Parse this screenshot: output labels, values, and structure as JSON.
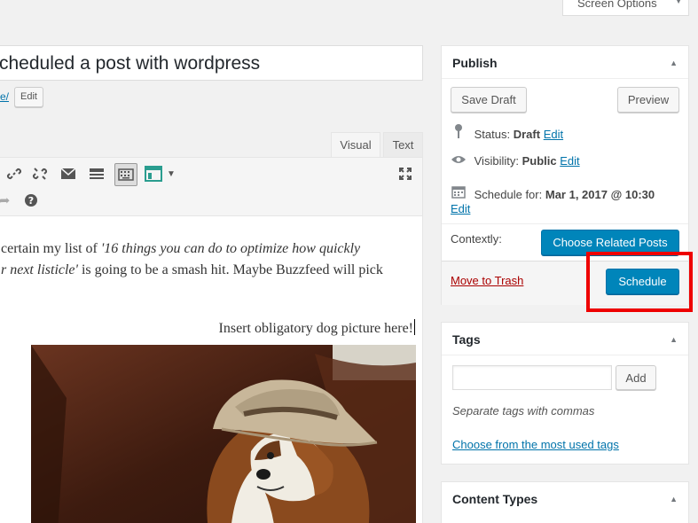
{
  "screen_options": {
    "label": "Screen Options",
    "arrow": "▼"
  },
  "post": {
    "title": "cheduled a post with wordpress",
    "permalink_tail": "e/",
    "edit_slug_label": "Edit"
  },
  "editor": {
    "tabs": {
      "visual": "Visual",
      "text": "Text"
    },
    "toolbar": {
      "row1": [
        "link-icon",
        "unlink-icon",
        "email-icon",
        "read-more-icon",
        "toolbar-toggle-icon",
        "content-block-icon",
        "dropdown-icon",
        "fullscreen-icon"
      ],
      "row2": [
        "redo-icon",
        "help-icon"
      ]
    },
    "content": {
      "p1_start": "certain my list of ",
      "p1_italic": "'16 things you can do to optimize how quickly",
      "p2_italic": "r next listicle'",
      "p2_rest": " is going to be a smash hit.  Maybe Buzzfeed will pick",
      "p3": "Insert obligatory dog picture here!"
    }
  },
  "publish": {
    "title": "Publish",
    "save_draft": "Save Draft",
    "preview": "Preview",
    "status_label": "Status:",
    "status_value": "Draft",
    "visibility_label": "Visibility:",
    "visibility_value": "Public",
    "schedule_label": "Schedule for:",
    "schedule_value": "Mar 1, 2017 @ 10:30",
    "edit": "Edit",
    "contextly_label": "Contextly:",
    "choose_related": "Choose Related Posts",
    "move_to_trash": "Move to Trash",
    "schedule_button": "Schedule"
  },
  "tags": {
    "title": "Tags",
    "add": "Add",
    "help": "Separate tags with commas",
    "choose_used": "Choose from the most used tags"
  },
  "content_types": {
    "title": "Content Types"
  },
  "colors": {
    "primary": "#0085ba",
    "link": "#0073aa",
    "trash": "#a00000",
    "highlight": "#ee0000"
  }
}
